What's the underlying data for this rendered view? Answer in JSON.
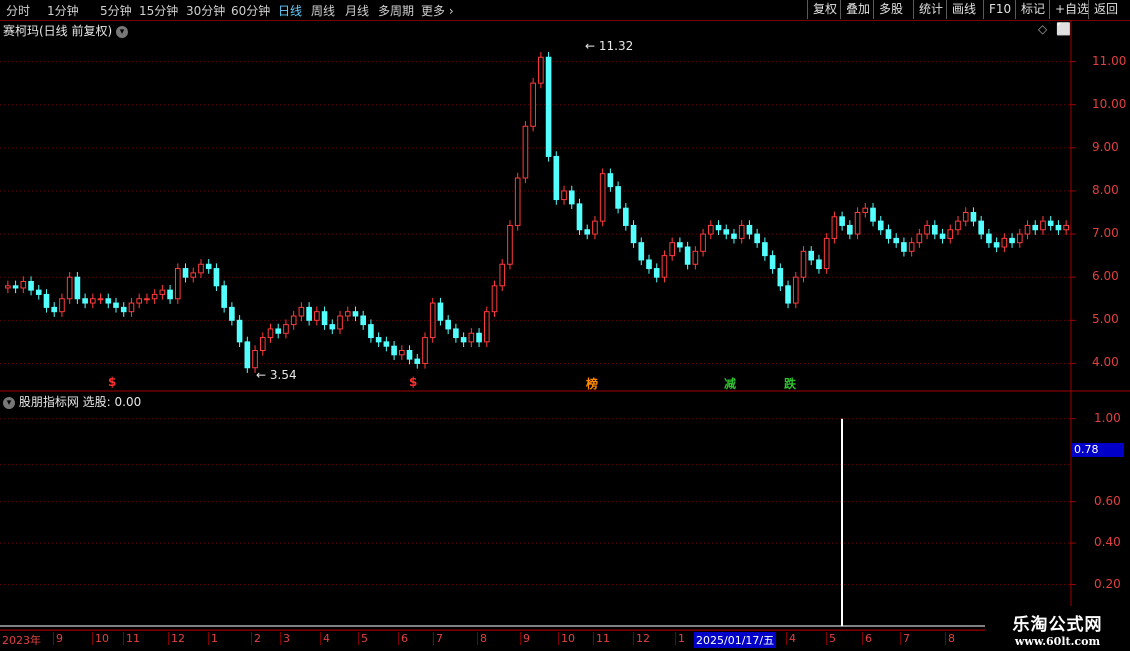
{
  "toolbar": {
    "timeframes": [
      "分时",
      "1分钟",
      "5分钟",
      "15分钟",
      "30分钟",
      "60分钟",
      "日线",
      "周线",
      "月线",
      "多周期",
      "更多"
    ],
    "active_timeframe": "日线",
    "buttons": [
      "复权",
      "叠加",
      "多股",
      "统计",
      "画线",
      "F10",
      "标记",
      "+自选",
      "返回"
    ]
  },
  "main_chart": {
    "title": "赛柯玛(日线 前复权)",
    "high_label": "11.32",
    "low_label": "3.54",
    "signals": [
      {
        "text": "$",
        "color": "#ff3030"
      },
      {
        "text": "$",
        "color": "#ff3030"
      },
      {
        "text": "榜",
        "color": "#ff8c00"
      },
      {
        "text": "减",
        "color": "#30c030"
      },
      {
        "text": "跌",
        "color": "#30c030"
      }
    ]
  },
  "indicator": {
    "title": "股朋指标网",
    "value_label": "选股: 0.00",
    "current_value": "0.78",
    "y_labels": [
      "1.00",
      "0.60",
      "0.40",
      "0.20"
    ]
  },
  "date_axis": {
    "year_label": "2023年",
    "month_labels": [
      "9",
      "10",
      "11",
      "12",
      "1",
      "2",
      "3",
      "4",
      "5",
      "6",
      "7",
      "8",
      "9",
      "10",
      "11",
      "12",
      "1",
      "4",
      "5",
      "6",
      "7",
      "8"
    ],
    "selected_date": "2025/01/17/五"
  },
  "watermark": {
    "line1": "乐淘公式网",
    "line2": "www.60lt.com"
  },
  "chart_data": {
    "type": "candlestick",
    "ylim": [
      3.5,
      11.5
    ],
    "yticks": [
      "11.00",
      "10.00",
      "9.00",
      "8.00",
      "7.00",
      "6.00",
      "5.00",
      "4.00"
    ],
    "closes": [
      5.8,
      5.75,
      5.9,
      5.7,
      5.6,
      5.3,
      5.2,
      5.5,
      6.0,
      5.5,
      5.4,
      5.5,
      5.5,
      5.4,
      5.3,
      5.2,
      5.4,
      5.5,
      5.5,
      5.6,
      5.7,
      5.5,
      6.2,
      6.0,
      6.1,
      6.3,
      6.2,
      5.8,
      5.3,
      5.0,
      4.5,
      3.9,
      4.3,
      4.6,
      4.8,
      4.7,
      4.9,
      5.1,
      5.3,
      5.0,
      5.2,
      4.9,
      4.8,
      5.1,
      5.2,
      5.1,
      4.9,
      4.6,
      4.5,
      4.4,
      4.2,
      4.3,
      4.1,
      4.0,
      4.6,
      5.4,
      5.0,
      4.8,
      4.6,
      4.5,
      4.7,
      4.5,
      5.2,
      5.8,
      6.3,
      7.2,
      8.3,
      9.5,
      10.5,
      11.1,
      8.8,
      7.8,
      8.0,
      7.7,
      7.1,
      7.0,
      7.3,
      8.4,
      8.1,
      7.6,
      7.2,
      6.8,
      6.4,
      6.2,
      6.0,
      6.5,
      6.8,
      6.7,
      6.3,
      6.6,
      7.0,
      7.2,
      7.1,
      7.0,
      6.9,
      7.2,
      7.0,
      6.8,
      6.5,
      6.2,
      5.8,
      5.4,
      6.0,
      6.6,
      6.4,
      6.2,
      6.9,
      7.4,
      7.2,
      7.0,
      7.5,
      7.6,
      7.3,
      7.1,
      6.9,
      6.8,
      6.6,
      6.8,
      7.0,
      7.2,
      7.0,
      6.9,
      7.1,
      7.3,
      7.5,
      7.3,
      7.0,
      6.8,
      6.7,
      6.9,
      6.8,
      7.0,
      7.2,
      7.1,
      7.3,
      7.2,
      7.1,
      7.2
    ],
    "indicator": {
      "type": "bar",
      "ylim": [
        0,
        1.1
      ],
      "signal_value": 1.0
    }
  }
}
